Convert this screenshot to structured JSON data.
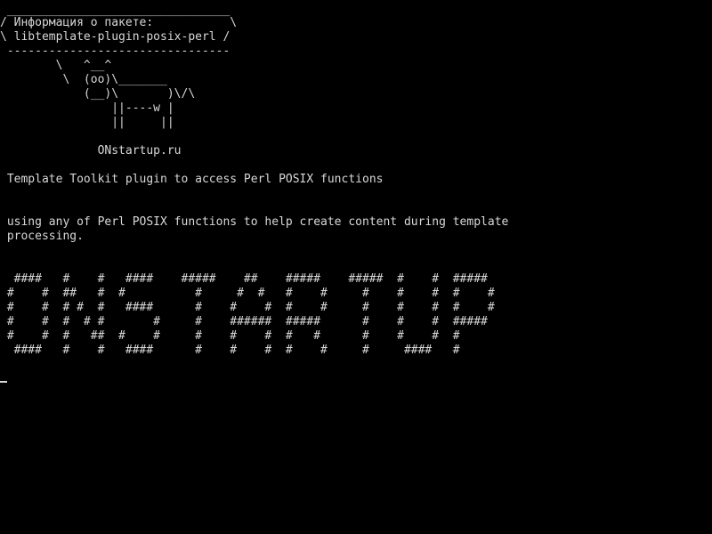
{
  "terminal": {
    "bubble": {
      "top_border": " ________________________________",
      "line1": "/ Информация о пакете:           \\",
      "line2": "\\ libtemplate-plugin-posix-perl /",
      "bottom_border": " --------------------------------"
    },
    "cow": [
      "        \\   ^__^",
      "         \\  (oo)\\_______",
      "            (__)\\       )\\/\\",
      "                ||----w |",
      "                ||     ||"
    ],
    "site": "              ONstartup.ru",
    "summary": " Template Toolkit plugin to access Perl POSIX functions",
    "description": [
      " using any of Perl POSIX functions to help create content during template",
      " processing."
    ],
    "banner": [
      "  ####   #    #   ####    #####    ##    #####    #####  #    #  #####",
      " #    #  ##   #  #          #     #  #   #    #     #    #    #  #    #",
      " #    #  # #  #   ####      #    #    #  #    #     #    #    #  #    #",
      " #    #  #  # #       #     #    ######  #####      #    #    #  #####",
      " #    #  #   ##  #    #     #    #    #  #   #      #    #    #  #",
      "  ####   #    #   ####      #    #    #  #    #     #     ####   #"
    ],
    "colors": {
      "background": "#000000",
      "foreground": "#d8d8d8"
    }
  }
}
